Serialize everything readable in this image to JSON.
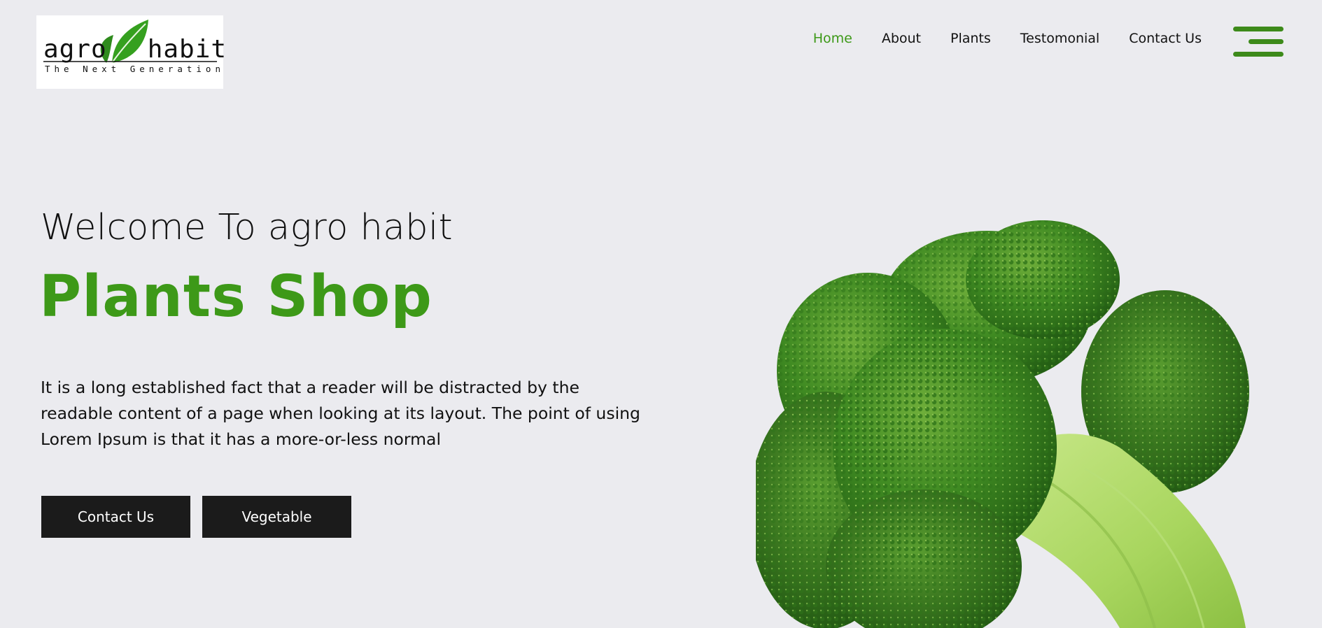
{
  "logo": {
    "word1": "agro",
    "word2": "habit",
    "tagline": "The Next Generation"
  },
  "nav": {
    "items": [
      "Home",
      "About",
      "Plants",
      "Testomonial",
      "Contact Us"
    ],
    "active": "Home"
  },
  "hero": {
    "welcome": "Welcome To agro habit",
    "title": "Plants Shop",
    "description": "It is a long established fact that a reader will be distracted by the readable content of a page when looking at its layout. The point of using Lorem Ipsum is that it has a more-or-less normal",
    "buttons": {
      "contact": "Contact Us",
      "vegetable": "Vegetable"
    },
    "image_icon": "broccoli-image"
  },
  "colors": {
    "accent": "#3d9918",
    "button_bg": "#1b1b1b",
    "page_bg": "#ebebef"
  },
  "icons": {
    "menu": "hamburger-menu-icon",
    "logo_leaf": "leaf-icon"
  }
}
